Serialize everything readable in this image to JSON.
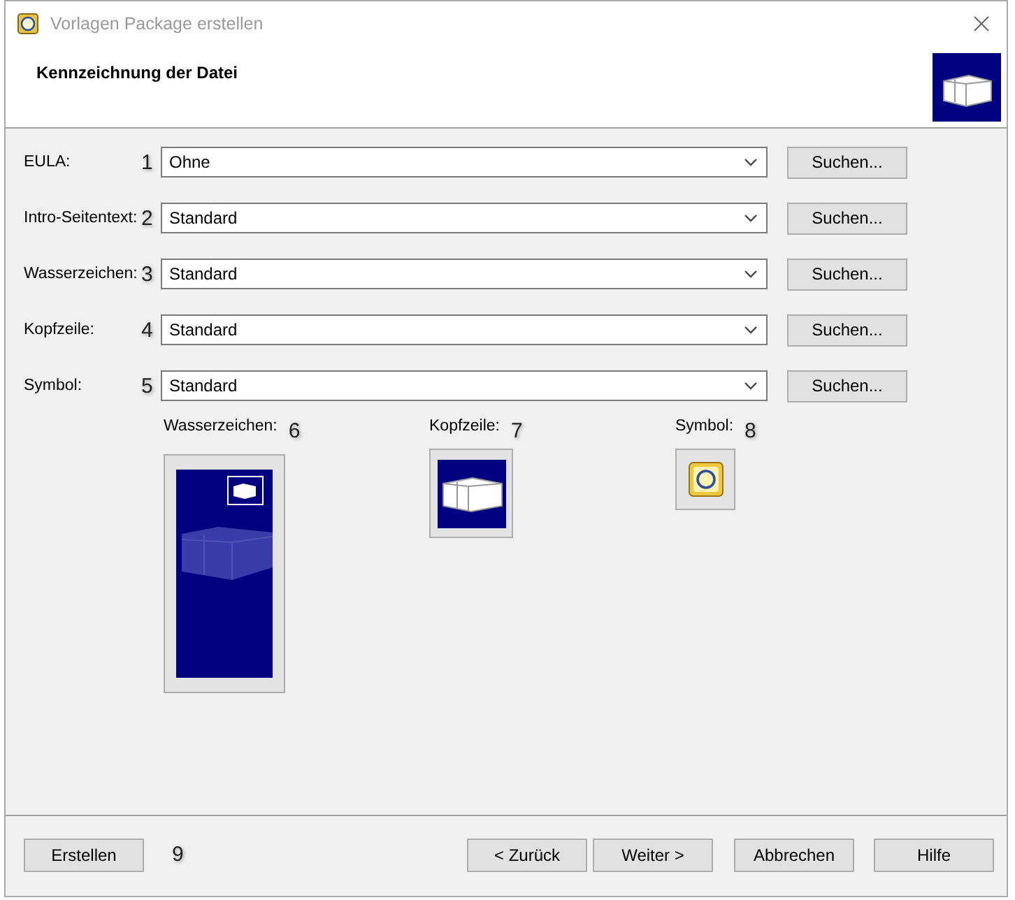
{
  "window": {
    "title": "Vorlagen Package erstellen"
  },
  "header": {
    "title": "Kennzeichnung der Datei"
  },
  "fields": [
    {
      "label": "EULA:",
      "callout": "1",
      "value": "Ohne",
      "button": "Suchen..."
    },
    {
      "label": "Intro-Seitentext:",
      "callout": "2",
      "value": "Standard",
      "button": "Suchen..."
    },
    {
      "label": "Wasserzeichen:",
      "callout": "3",
      "value": "Standard",
      "button": "Suchen..."
    },
    {
      "label": "Kopfzeile:",
      "callout": "4",
      "value": "Standard",
      "button": "Suchen..."
    },
    {
      "label": "Symbol:",
      "callout": "5",
      "value": "Standard",
      "button": "Suchen..."
    }
  ],
  "previews": [
    {
      "label": "Wasserzeichen:",
      "callout": "6",
      "kind": "watermark"
    },
    {
      "label": "Kopfzeile:",
      "callout": "7",
      "kind": "header"
    },
    {
      "label": "Symbol:",
      "callout": "8",
      "kind": "symbol"
    }
  ],
  "footer": {
    "left_button": {
      "label": "Erstellen",
      "callout": "9"
    },
    "buttons": [
      "< Zurück",
      "Weiter >",
      "Abbrechen",
      "Hilfe"
    ]
  }
}
